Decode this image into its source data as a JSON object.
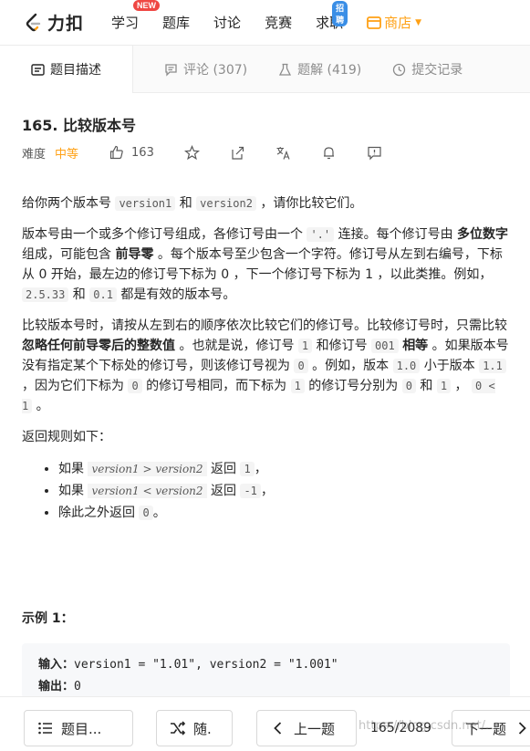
{
  "nav": {
    "logo_text": "力扣",
    "items": [
      {
        "label": "学习",
        "badge": "NEW"
      },
      {
        "label": "题库",
        "badge": ""
      },
      {
        "label": "讨论",
        "badge": ""
      },
      {
        "label": "竞赛",
        "badge": ""
      },
      {
        "label": "求职",
        "badge": "招聘"
      }
    ],
    "store_label": "商店",
    "accent": "#ffa116"
  },
  "tabs": [
    {
      "label": "题目描述",
      "icon": "description-icon"
    },
    {
      "label": "评论 (307)",
      "icon": "comment-icon"
    },
    {
      "label": "题解 (419)",
      "icon": "flask-icon"
    },
    {
      "label": "提交记录",
      "icon": "history-icon"
    }
  ],
  "problem": {
    "title": "165. 比较版本号",
    "difficulty_label": "难度",
    "difficulty": "中等",
    "likes": "163"
  },
  "description": {
    "p1_a": "给你两个版本号 ",
    "p1_code1": "version1",
    "p1_b": " 和 ",
    "p1_code2": "version2",
    "p1_c": " ，请你比较它们。",
    "p2_a": "版本号由一个或多个修订号组成，各修订号由一个 ",
    "p2_code1": "'.'",
    "p2_b": " 连接。每个修订号由 ",
    "p2_bold1": "多位数字",
    "p2_c": " 组成，可能包含 ",
    "p2_bold2": "前导零",
    "p2_d": " 。每个版本号至少包含一个字符。修订号从左到右编号，下标从 0 开始，最左边的修订号下标为 0 ，下一个修订号下标为 1 ，以此类推。例如， ",
    "p2_code2": "2.5.33",
    "p2_e": " 和 ",
    "p2_code3": "0.1",
    "p2_f": " 都是有效的版本号。",
    "p3_a": "比较版本号时，请按从左到右的顺序依次比较它们的修订号。比较修订号时，只需比较 ",
    "p3_bold1": "忽略任何前导零后的整数值",
    "p3_b": " 。也就是说，修订号 ",
    "p3_code1": "1",
    "p3_c": " 和修订号 ",
    "p3_code2": "001",
    "p3_d": " ",
    "p3_bold2": "相等",
    "p3_e": " 。如果版本号没有指定某个下标处的修订号，则该修订号视为 ",
    "p3_code3": "0",
    "p3_f": " 。例如，版本 ",
    "p3_code4": "1.0",
    "p3_g": " 小于版本 ",
    "p3_code5": "1.1",
    "p3_h": " ，因为它们下标为 ",
    "p3_code6": "0",
    "p3_i": " 的修订号相同，而下标为 ",
    "p3_code7": "1",
    "p3_j": " 的修订号分别为 ",
    "p3_code8": "0",
    "p3_k": " 和 ",
    "p3_code9": "1",
    "p3_l": " ， ",
    "p3_code10": "0 < 1",
    "p3_m": " 。",
    "p4": "返回规则如下：",
    "rules": [
      {
        "pre": "如果 ",
        "expr": "version1  >  version2",
        "mid": " 返回 ",
        "ret": "1",
        "post": "，"
      },
      {
        "pre": "如果 ",
        "expr": "version1  <  version2",
        "mid": " 返回 ",
        "ret": "-1",
        "post": "，"
      },
      {
        "pre": "除此之外返回 ",
        "expr": "",
        "mid": "",
        "ret": "0",
        "post": "。"
      }
    ]
  },
  "example": {
    "title": "示例 1：",
    "input_label": "输入：",
    "input_value": "version1 = \"1.01\", version2 = \"1.001\"",
    "output_label": "输出：",
    "output_value": "0"
  },
  "bottom": {
    "list_label": "题目...",
    "random_label": "随.",
    "prev_label": "上一题",
    "pager": "165/2089",
    "next_label": "下一题",
    "watermark": "https://blog.csdn.net/..."
  }
}
